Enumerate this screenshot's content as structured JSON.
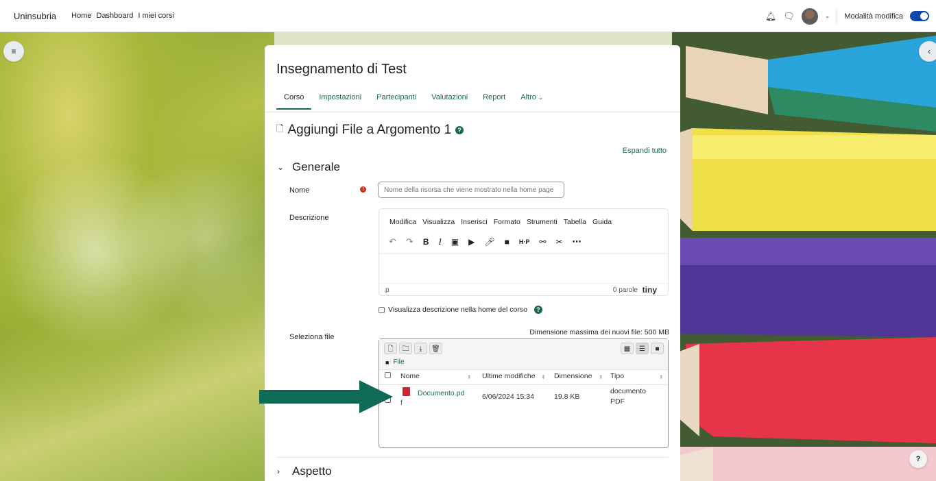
{
  "navbar": {
    "brand": "Uninsubria",
    "links": [
      "Home",
      "Dashboard",
      "I miei corsi"
    ],
    "edit_mode_label": "Modalità modifica",
    "edit_mode_on": true
  },
  "course": {
    "title": "Insegnamento di Test",
    "tabs": [
      "Corso",
      "Impostazioni",
      "Partecipanti",
      "Valutazioni",
      "Report",
      "Altro"
    ],
    "active_tab": "Corso"
  },
  "page": {
    "heading": "Aggiungi File a Argomento 1",
    "expand_all": "Espandi tutto"
  },
  "sections": {
    "generale": "Generale",
    "aspetto": "Aspetto"
  },
  "form": {
    "name_label": "Nome",
    "name_placeholder": "Nome della risorsa che viene mostrato nella home page",
    "description_label": "Descrizione",
    "show_description_label": "Visualizza descrizione nella home del corso",
    "select_files_label": "Seleziona file",
    "max_size": "Dimensione massima dei nuovi file: 500 MB"
  },
  "editor": {
    "menu": [
      "Modifica",
      "Visualizza",
      "Inserisci",
      "Formato",
      "Strumenti",
      "Tabella",
      "Guida"
    ],
    "status_tag": "p",
    "word_count": "0 parole",
    "brand": "tiny"
  },
  "filemanager": {
    "path_label": "File",
    "columns": {
      "name": "Nome",
      "modified": "Ultime modifiche",
      "size": "Dimensione",
      "type": "Tipo"
    },
    "files": [
      {
        "name_line1": "Documento.pd",
        "name_line2": "f",
        "modified": "6/06/2024 15:34",
        "size": "19.8 KB",
        "type_line1": "documento",
        "type_line2": "PDF"
      }
    ]
  },
  "colors": {
    "accent": "#196a46",
    "arrow": "#0f6b55",
    "required": "#ca3120",
    "toggle": "#0f47ad"
  }
}
